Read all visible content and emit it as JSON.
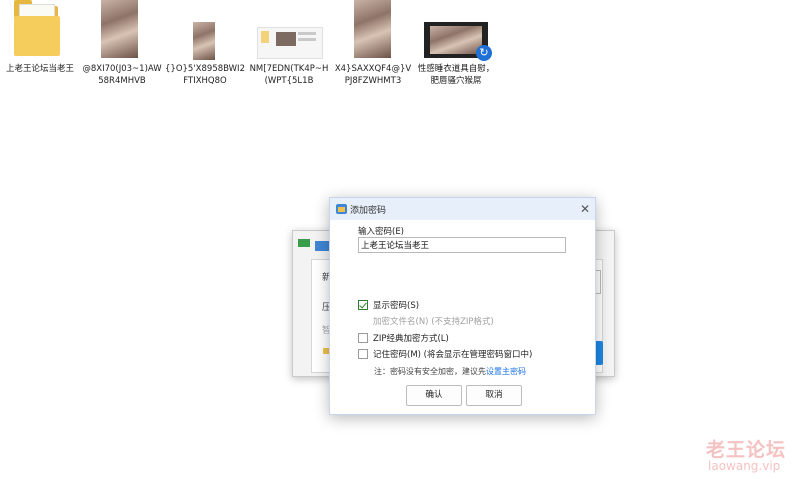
{
  "desktop": {
    "icons": [
      {
        "label": "上老王论坛当老王",
        "type": "folder"
      },
      {
        "label": "@8XI70(J03~1)AW58R4MHVB",
        "type": "image"
      },
      {
        "label": "{}O}5'X8958BWI2FTIXHQ8O",
        "type": "image"
      },
      {
        "label": "NM[7EDN(TK4P~H(WPT{5L1B",
        "type": "image"
      },
      {
        "label": "X4}SAXXQF4@}VPJ8FZWHMT3",
        "type": "image"
      },
      {
        "label": "性感睡衣道具自慰，肥唇骚穴猴屌",
        "type": "video"
      }
    ]
  },
  "background_window": {
    "letters": [
      "新",
      "压",
      "智"
    ]
  },
  "dialog": {
    "title": "添加密码",
    "close_icon": "close-icon",
    "password_label": "输入密码(E)",
    "password_value": "上老王论坛当老王",
    "options": [
      {
        "label": "显示密码(S)",
        "checked": true,
        "disabled": false
      },
      {
        "label": "加密文件名(N) (不支持ZIP格式)",
        "checked": false,
        "disabled": true
      },
      {
        "label": "ZIP经典加密方式(L)",
        "checked": false,
        "disabled": false
      },
      {
        "label": "记住密码(M) (将会显示在管理密码窗口中)",
        "checked": false,
        "disabled": false
      }
    ],
    "note_prefix": "注：密码没有安全加密，建议先",
    "note_link": "设置主密码",
    "ok_label": "确认",
    "cancel_label": "取消"
  },
  "watermark": {
    "line1": "老王论坛",
    "line2": "laowang.vip"
  }
}
